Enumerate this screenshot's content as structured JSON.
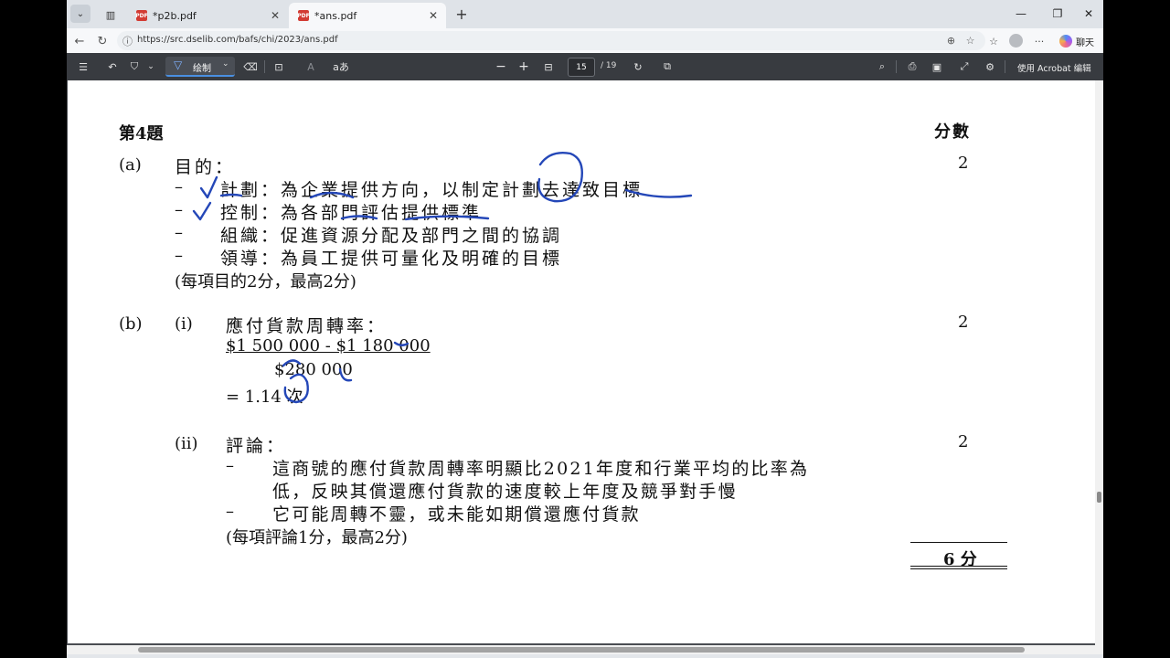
{
  "tabs": [
    {
      "title": "*p2b.pdf",
      "icon": "pdf-icon"
    },
    {
      "title": "*ans.pdf",
      "icon": "pdf-icon",
      "active": true
    }
  ],
  "address": {
    "url": "https://src.dselib.com/bafs/chi/2023/ans.pdf"
  },
  "toolbar": {
    "chat_label": "聊天"
  },
  "pdf_toolbar": {
    "draw_label": "绘制",
    "page_current": "15",
    "page_total": "/ 19",
    "acrobat_label": "使用 Acrobat 编辑"
  },
  "doc": {
    "question_title": "第4題",
    "marks_header": "分數",
    "a": {
      "label": "(a)",
      "heading": "目的：",
      "dash": "–",
      "items": [
        "計劃：為企業提供方向，以制定計劃去達致目標",
        "控制：為各部門評估提供標準",
        "組織：促進資源分配及部門之間的協調",
        "領導：為員工提供可量化及明確的目標"
      ],
      "note": "(每項目的2分，最高2分)",
      "marks": "2"
    },
    "b": {
      "label": "(b)",
      "i_label": "(i)",
      "i_heading": "應付貨款周轉率：",
      "numerator": "$1 500 000 - $1 180 000",
      "denominator": "$280 000",
      "result": "= 1.14 次",
      "i_marks": "2",
      "ii_label": "(ii)",
      "ii_heading": "評論：",
      "dash": "–",
      "ii_item1_line1": "這商號的應付貨款周轉率明顯比2021年度和行業平均的比率為",
      "ii_item1_line2": "低，反映其償還應付貨款的速度較上年度及競爭對手慢",
      "ii_item2": "它可能周轉不靈，或未能如期償還應付貨款",
      "ii_note": "(每項評論1分，最高2分)",
      "ii_marks": "2"
    },
    "total": "6 分"
  },
  "colors": {
    "ink": "#2447b8",
    "pdf_toolbar": "#383b40",
    "accent": "#4a90e2"
  }
}
